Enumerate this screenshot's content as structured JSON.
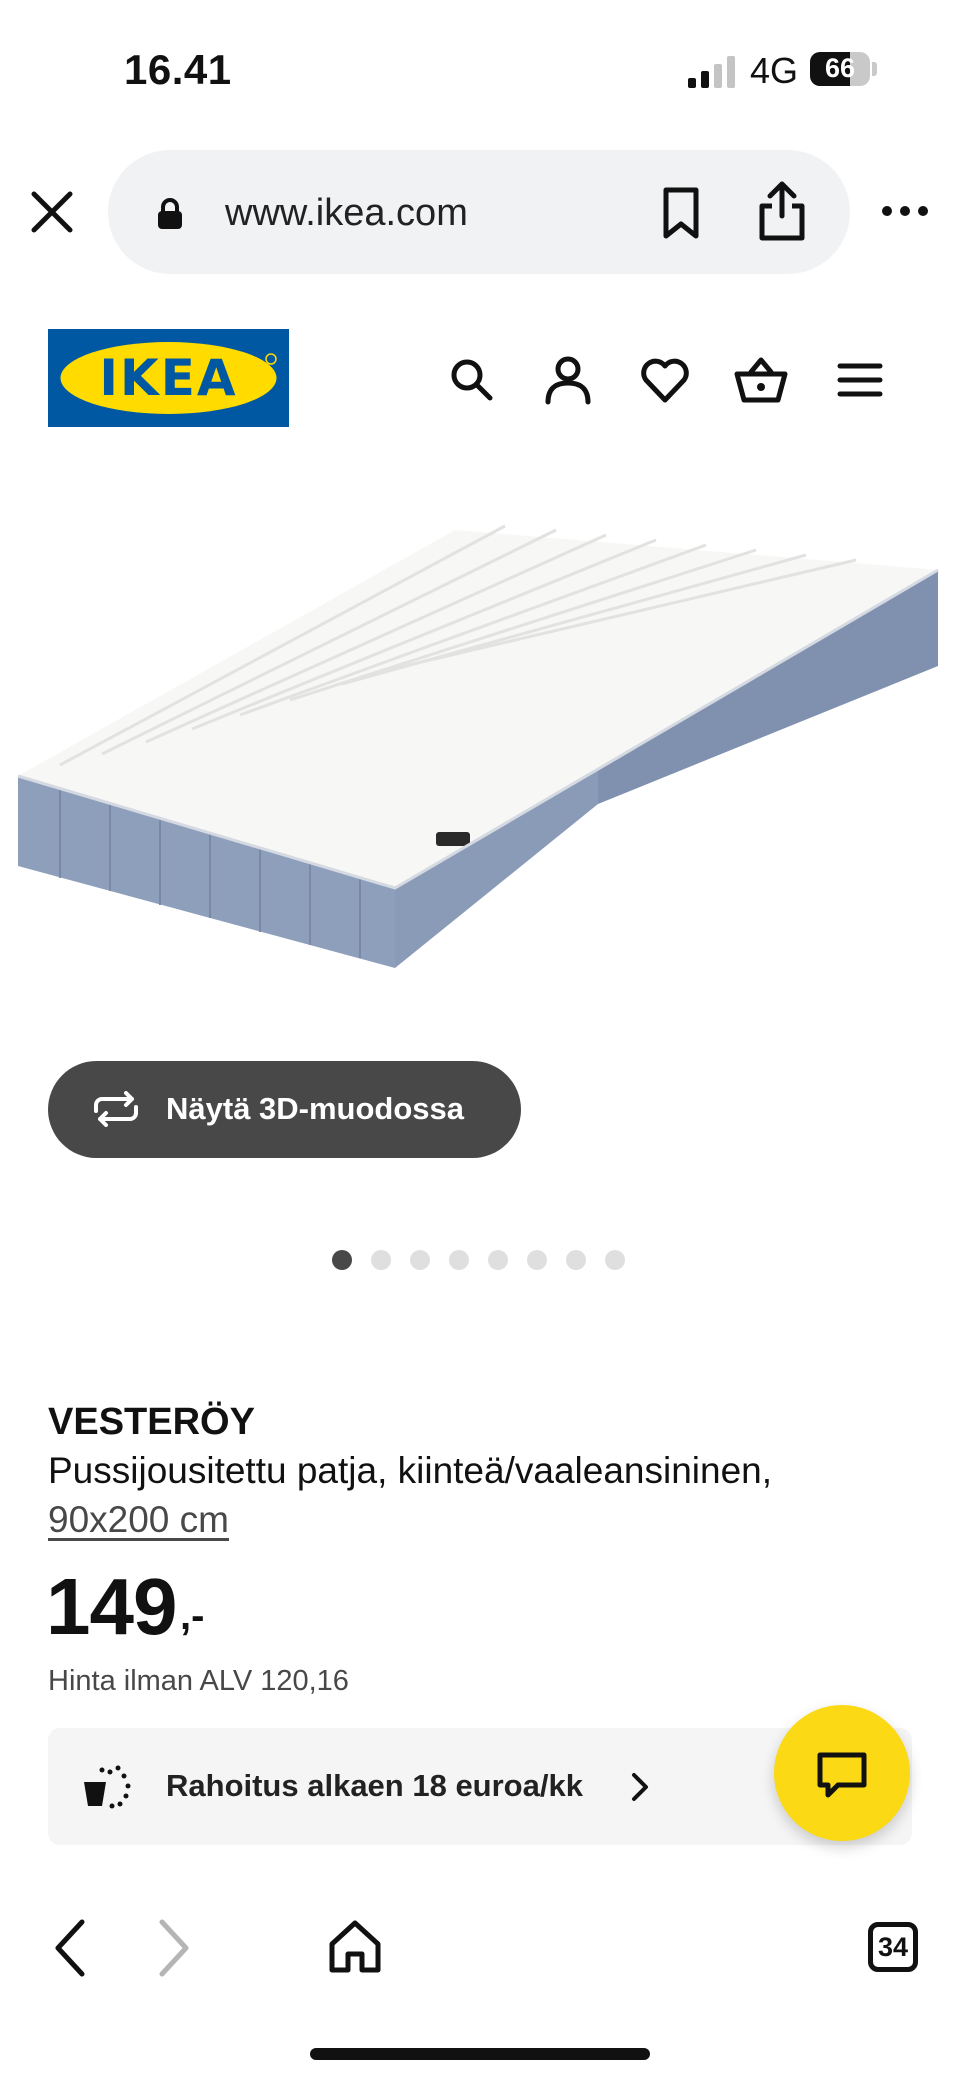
{
  "status_bar": {
    "time": "16.41",
    "network": "4G",
    "battery_level": "66",
    "battery_fraction": 0.66
  },
  "browser": {
    "url": "www.ikea.com",
    "icons": [
      "close-icon",
      "lock-icon",
      "bookmark-icon",
      "share-icon",
      "more-icon"
    ]
  },
  "header": {
    "logo_text": "IKEA",
    "logo_colors": {
      "blue": "#0058a3",
      "yellow": "#ffdb00"
    },
    "icons": [
      "search-icon",
      "user-icon",
      "heart-icon",
      "basket-icon",
      "menu-icon"
    ]
  },
  "gallery": {
    "view_3d_label": "Näytä 3D-muodossa",
    "image_count": 8,
    "active_index": 0
  },
  "product": {
    "name": "VESTERÖY",
    "description": "Pussijousitettu patja, kiinteä/vaaleansininen,",
    "size": "90x200 cm",
    "price": "149",
    "price_suffix": ",-",
    "price_without_vat": "Hinta ilman ALV 120,16"
  },
  "finance": {
    "label": "Rahoitus alkaen 18 euroa/kk",
    "icon": "payment-icon"
  },
  "chat": {
    "icon": "chat-icon",
    "color": "#fbd914"
  },
  "toolbar": {
    "tab_count": "34",
    "icons": [
      "back-icon",
      "forward-icon",
      "home-icon",
      "tabs-icon"
    ]
  }
}
